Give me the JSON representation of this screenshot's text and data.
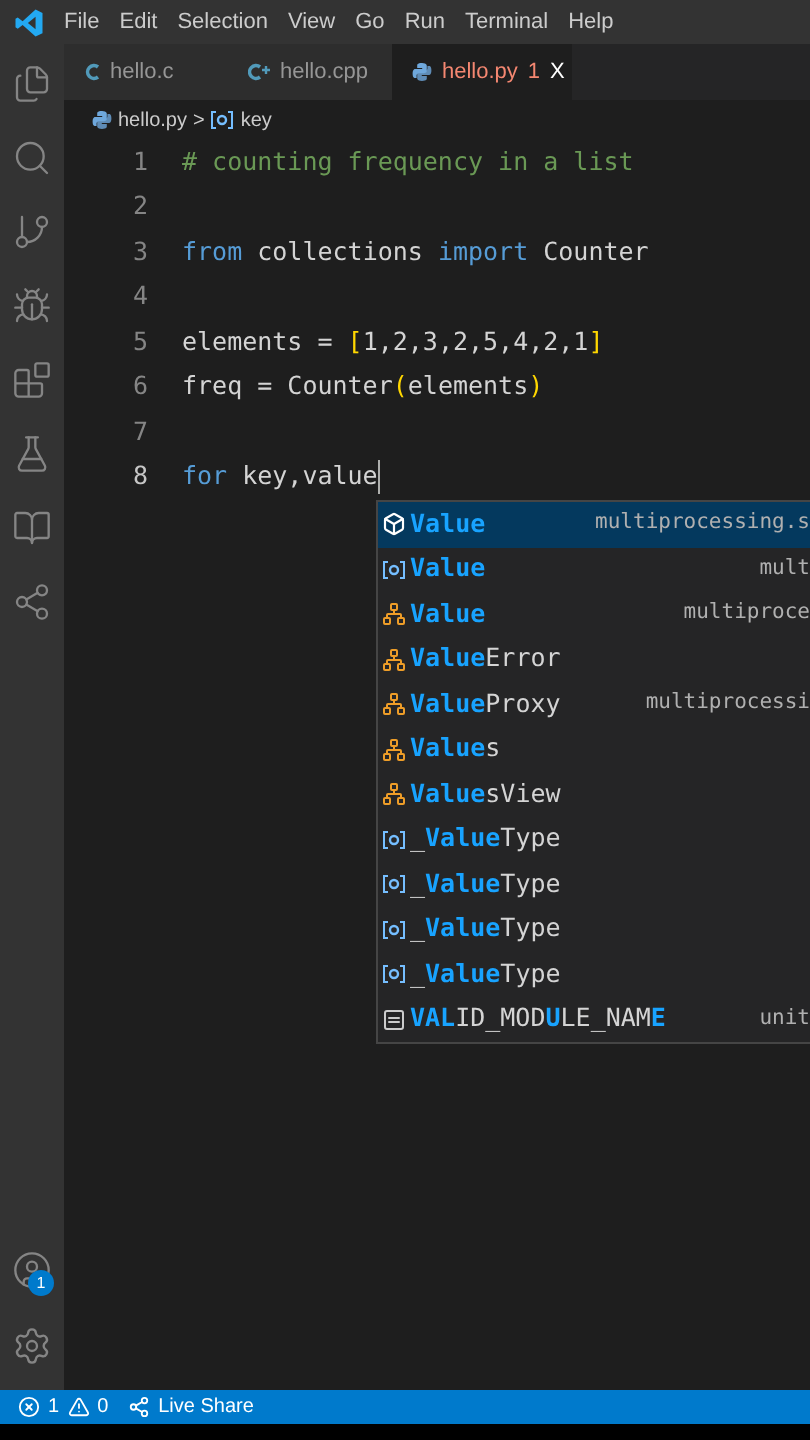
{
  "menu": [
    "File",
    "Edit",
    "Selection",
    "View",
    "Go",
    "Run",
    "Terminal",
    "Help"
  ],
  "activity_bar": {
    "items": [
      {
        "kind": "explorer"
      },
      {
        "kind": "search"
      },
      {
        "kind": "source-control"
      },
      {
        "kind": "run"
      },
      {
        "kind": "extensions"
      },
      {
        "kind": "testing"
      },
      {
        "kind": "notebook"
      },
      {
        "kind": "live-share"
      }
    ],
    "account_badge": "1"
  },
  "tabs": [
    {
      "label": "hello.c",
      "kind": "c",
      "selected": false
    },
    {
      "label": "hello.cpp",
      "kind": "cpp",
      "selected": false
    },
    {
      "label": "hello.py",
      "kind": "python",
      "selected": true,
      "problems": "1",
      "close": "X"
    }
  ],
  "breadcrumb": {
    "file": "hello.py",
    "separator": ">",
    "symbol": "key"
  },
  "code": [
    {
      "number": "1",
      "tokens": [
        {
          "kind": "comment",
          "text": "# counting frequency in a list"
        }
      ]
    },
    {
      "number": "2"
    },
    {
      "number": "3",
      "tokens": [
        {
          "kind": "keyword",
          "text": "from"
        },
        {
          "kind": "plain",
          "text": " collections "
        },
        {
          "kind": "keyword",
          "text": "import"
        },
        {
          "kind": "plain",
          "text": " Counter"
        }
      ]
    },
    {
      "number": "4"
    },
    {
      "number": "5",
      "tokens": [
        {
          "kind": "plain",
          "text": "elements = "
        },
        {
          "kind": "bracket",
          "text": "["
        },
        {
          "kind": "plain",
          "text": "1,2,3,2,5,4,2,1"
        },
        {
          "kind": "bracket",
          "text": "]"
        }
      ]
    },
    {
      "number": "6",
      "tokens": [
        {
          "kind": "plain",
          "text": "freq = Counter"
        },
        {
          "kind": "bracket",
          "text": "("
        },
        {
          "kind": "plain",
          "text": "elements"
        },
        {
          "kind": "bracket",
          "text": ")"
        }
      ]
    },
    {
      "number": "7"
    },
    {
      "number": "8",
      "tokens": [
        {
          "kind": "keyword",
          "text": "for"
        },
        {
          "kind": "plain",
          "text": " key,value"
        }
      ],
      "cursor": true
    }
  ],
  "suggestions": [
    {
      "kind": "symbol",
      "selected": true,
      "label": "**Value**",
      "detail": "multiprocessing.s"
    },
    {
      "kind": "variable",
      "selected": false,
      "label": "**Value**",
      "detail": "mult"
    },
    {
      "kind": "class",
      "selected": false,
      "label": "**Value**",
      "detail": "multiproce"
    },
    {
      "kind": "class",
      "selected": false,
      "label": "**Value**Error"
    },
    {
      "kind": "class",
      "selected": false,
      "label": "**Value**Proxy",
      "detail": "multiprocessi"
    },
    {
      "kind": "class",
      "selected": false,
      "label": "**Value**s"
    },
    {
      "kind": "class",
      "selected": false,
      "label": "**Value**sView"
    },
    {
      "kind": "variable",
      "selected": false,
      "label": "_**Value**Type"
    },
    {
      "kind": "variable",
      "selected": false,
      "label": "_**Value**Type"
    },
    {
      "kind": "variable",
      "selected": false,
      "label": "_**Value**Type"
    },
    {
      "kind": "variable",
      "selected": false,
      "label": "_**Value**Type"
    },
    {
      "kind": "constant",
      "selected": false,
      "label": "**VAL**ID_MOD**U**LE_NAM**E**",
      "detail": "unit"
    }
  ],
  "status_bar": {
    "errors": "1",
    "warnings": "0",
    "live_share": "Live Share"
  }
}
